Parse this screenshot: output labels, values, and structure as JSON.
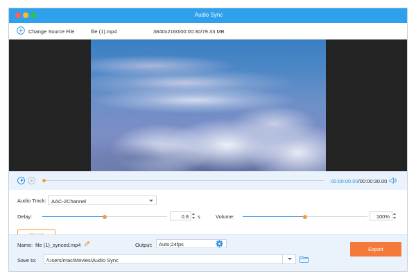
{
  "window": {
    "title": "Audio Sync"
  },
  "source": {
    "change_label": "Change Source File",
    "file_name": "file (1).mp4",
    "file_meta": "3840x2160/00:00:30/79.33 MB"
  },
  "player": {
    "progress": 0.0,
    "current_time": "00:00:00.00",
    "total_time": "/00:00:30.00"
  },
  "settings": {
    "audio_track_label": "Audio Track:",
    "audio_track_value": "AAC-2Channel",
    "delay_label": "Delay:",
    "delay_value": "0.8",
    "delay_unit": "s",
    "delay_level": 0.5,
    "volume_label": "Volume:",
    "volume_value": "100%",
    "volume_level": 0.5,
    "reset_label": "Reset"
  },
  "bottom": {
    "name_label": "Name:",
    "name_value": "file (1)_synced.mp4",
    "output_label": "Output:",
    "output_value": "Auto;24fps",
    "save_label": "Save to:",
    "save_path": "/Users/mac/Movies/Audio Sync",
    "export_label": "Export"
  },
  "colors": {
    "title_bar": "#2fa0ec",
    "accent": "#2f8fe0",
    "slider_knob": "#f59a3a",
    "export_button": "#f47a3b"
  },
  "icons": {
    "add_source": "plus-circle-icon",
    "play": "play-icon",
    "stop": "stop-icon",
    "volume": "speaker-icon",
    "edit_name": "pencil-icon",
    "output_settings": "gear-icon",
    "open_folder": "folder-icon"
  }
}
